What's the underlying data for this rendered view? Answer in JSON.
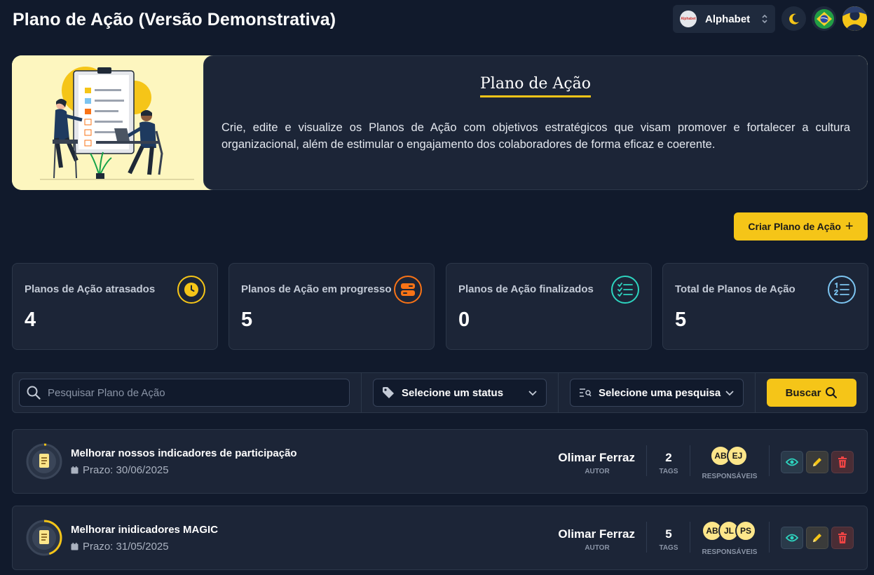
{
  "header": {
    "title": "Plano de Ação (Versão Demonstrativa)",
    "company": {
      "name": "Alphabet",
      "logo_text": "Alphabet"
    }
  },
  "hero": {
    "title": "Plano de Ação",
    "description": "Crie, edite e visualize os Planos de Ação com objetivos estratégicos que visam promover e fortalecer a cultura organizacional, além de estimular o engajamento dos colaboradores de forma eficaz e coerente."
  },
  "actions": {
    "create_label": "Criar Plano de Ação"
  },
  "stats": [
    {
      "label": "Planos de Ação atrasados",
      "value": "4",
      "icon": "clock-icon",
      "color": "#f5c518"
    },
    {
      "label": "Planos de Ação em progresso",
      "value": "5",
      "icon": "progress-icon",
      "color": "#f97316"
    },
    {
      "label": "Planos de Ação finalizados",
      "value": "0",
      "icon": "checklist-icon",
      "color": "#2dd4bf"
    },
    {
      "label": "Total de Planos de Ação",
      "value": "5",
      "icon": "numbered-list-icon",
      "color": "#7cc4f0"
    }
  ],
  "filters": {
    "search_placeholder": "Pesquisar Plano de Ação",
    "status_label": "Selecione um status",
    "research_label": "Selecione uma pesquisa",
    "search_button": "Buscar"
  },
  "plans": [
    {
      "title": "Melhorar nossos indicadores de participação",
      "deadline": "Prazo: 30/06/2025",
      "author": "Olimar Ferraz",
      "author_label": "AUTOR",
      "tags": "2",
      "tags_label": "TAGS",
      "responsibles": [
        "AB",
        "EJ"
      ],
      "responsibles_label": "RESPONSÁVEIS",
      "progress": 0.02
    },
    {
      "title": "Melhorar inidicadores MAGIC",
      "deadline": "Prazo: 31/05/2025",
      "author": "Olimar Ferraz",
      "author_label": "AUTOR",
      "tags": "5",
      "tags_label": "TAGS",
      "responsibles": [
        "AB",
        "JL",
        "PS"
      ],
      "responsibles_label": "RESPONSÁVEIS",
      "progress": 0.45
    }
  ]
}
